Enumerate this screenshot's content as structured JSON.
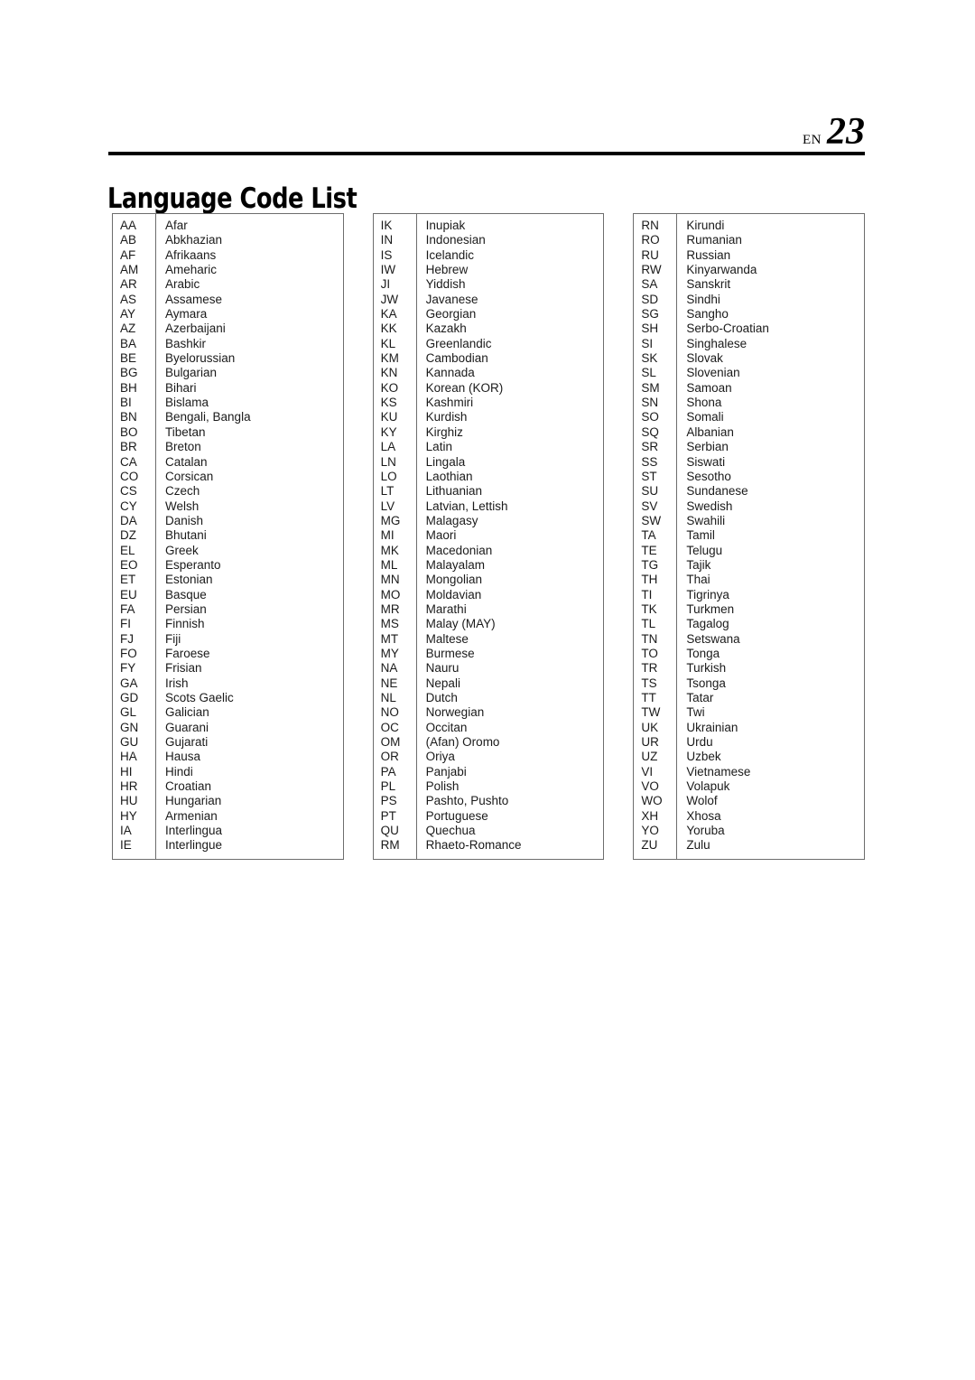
{
  "header": {
    "locale_label": "EN",
    "page_number": "23"
  },
  "title": "Language Code List",
  "tables": [
    {
      "name": "language-code-table-1",
      "rows": [
        {
          "code": "AA",
          "language": "Afar"
        },
        {
          "code": "AB",
          "language": "Abkhazian"
        },
        {
          "code": "AF",
          "language": "Afrikaans"
        },
        {
          "code": "AM",
          "language": "Ameharic"
        },
        {
          "code": "AR",
          "language": "Arabic"
        },
        {
          "code": "AS",
          "language": "Assamese"
        },
        {
          "code": "AY",
          "language": "Aymara"
        },
        {
          "code": "AZ",
          "language": "Azerbaijani"
        },
        {
          "code": "BA",
          "language": "Bashkir"
        },
        {
          "code": "BE",
          "language": "Byelorussian"
        },
        {
          "code": "BG",
          "language": "Bulgarian"
        },
        {
          "code": "BH",
          "language": "Bihari"
        },
        {
          "code": "BI",
          "language": "Bislama"
        },
        {
          "code": "BN",
          "language": "Bengali, Bangla"
        },
        {
          "code": "BO",
          "language": "Tibetan"
        },
        {
          "code": "BR",
          "language": "Breton"
        },
        {
          "code": "CA",
          "language": "Catalan"
        },
        {
          "code": "CO",
          "language": "Corsican"
        },
        {
          "code": "CS",
          "language": "Czech"
        },
        {
          "code": "CY",
          "language": "Welsh"
        },
        {
          "code": "DA",
          "language": "Danish"
        },
        {
          "code": "DZ",
          "language": "Bhutani"
        },
        {
          "code": "EL",
          "language": "Greek"
        },
        {
          "code": "EO",
          "language": "Esperanto"
        },
        {
          "code": "ET",
          "language": "Estonian"
        },
        {
          "code": "EU",
          "language": "Basque"
        },
        {
          "code": "FA",
          "language": "Persian"
        },
        {
          "code": "FI",
          "language": "Finnish"
        },
        {
          "code": "FJ",
          "language": "Fiji"
        },
        {
          "code": "FO",
          "language": "Faroese"
        },
        {
          "code": "FY",
          "language": "Frisian"
        },
        {
          "code": "GA",
          "language": "Irish"
        },
        {
          "code": "GD",
          "language": "Scots Gaelic"
        },
        {
          "code": "GL",
          "language": "Galician"
        },
        {
          "code": "GN",
          "language": "Guarani"
        },
        {
          "code": "GU",
          "language": "Gujarati"
        },
        {
          "code": "HA",
          "language": "Hausa"
        },
        {
          "code": "HI",
          "language": "Hindi"
        },
        {
          "code": "HR",
          "language": "Croatian"
        },
        {
          "code": "HU",
          "language": "Hungarian"
        },
        {
          "code": "HY",
          "language": "Armenian"
        },
        {
          "code": "IA",
          "language": "Interlingua"
        },
        {
          "code": "IE",
          "language": "Interlingue"
        }
      ]
    },
    {
      "name": "language-code-table-2",
      "rows": [
        {
          "code": "IK",
          "language": "Inupiak"
        },
        {
          "code": "IN",
          "language": "Indonesian"
        },
        {
          "code": "IS",
          "language": "Icelandic"
        },
        {
          "code": "IW",
          "language": "Hebrew"
        },
        {
          "code": "JI",
          "language": "Yiddish"
        },
        {
          "code": "JW",
          "language": "Javanese"
        },
        {
          "code": "KA",
          "language": "Georgian"
        },
        {
          "code": "KK",
          "language": "Kazakh"
        },
        {
          "code": "KL",
          "language": "Greenlandic"
        },
        {
          "code": "KM",
          "language": "Cambodian"
        },
        {
          "code": "KN",
          "language": "Kannada"
        },
        {
          "code": "KO",
          "language": "Korean (KOR)"
        },
        {
          "code": "KS",
          "language": "Kashmiri"
        },
        {
          "code": "KU",
          "language": "Kurdish"
        },
        {
          "code": "KY",
          "language": "Kirghiz"
        },
        {
          "code": "LA",
          "language": "Latin"
        },
        {
          "code": "LN",
          "language": "Lingala"
        },
        {
          "code": "LO",
          "language": "Laothian"
        },
        {
          "code": "LT",
          "language": "Lithuanian"
        },
        {
          "code": "LV",
          "language": "Latvian, Lettish"
        },
        {
          "code": "MG",
          "language": "Malagasy"
        },
        {
          "code": "MI",
          "language": "Maori"
        },
        {
          "code": "MK",
          "language": "Macedonian"
        },
        {
          "code": "ML",
          "language": "Malayalam"
        },
        {
          "code": "MN",
          "language": "Mongolian"
        },
        {
          "code": "MO",
          "language": "Moldavian"
        },
        {
          "code": "MR",
          "language": "Marathi"
        },
        {
          "code": "MS",
          "language": "Malay (MAY)"
        },
        {
          "code": "MT",
          "language": "Maltese"
        },
        {
          "code": "MY",
          "language": "Burmese"
        },
        {
          "code": "NA",
          "language": "Nauru"
        },
        {
          "code": "NE",
          "language": "Nepali"
        },
        {
          "code": "NL",
          "language": "Dutch"
        },
        {
          "code": "NO",
          "language": "Norwegian"
        },
        {
          "code": "OC",
          "language": "Occitan"
        },
        {
          "code": "OM",
          "language": "(Afan) Oromo"
        },
        {
          "code": "OR",
          "language": "Oriya"
        },
        {
          "code": "PA",
          "language": "Panjabi"
        },
        {
          "code": "PL",
          "language": "Polish"
        },
        {
          "code": "PS",
          "language": "Pashto, Pushto"
        },
        {
          "code": "PT",
          "language": "Portuguese"
        },
        {
          "code": "QU",
          "language": "Quechua"
        },
        {
          "code": "RM",
          "language": "Rhaeto-Romance"
        }
      ]
    },
    {
      "name": "language-code-table-3",
      "rows": [
        {
          "code": "RN",
          "language": "Kirundi"
        },
        {
          "code": "RO",
          "language": "Rumanian"
        },
        {
          "code": "RU",
          "language": "Russian"
        },
        {
          "code": "RW",
          "language": "Kinyarwanda"
        },
        {
          "code": "SA",
          "language": "Sanskrit"
        },
        {
          "code": "SD",
          "language": "Sindhi"
        },
        {
          "code": "SG",
          "language": "Sangho"
        },
        {
          "code": "SH",
          "language": "Serbo-Croatian"
        },
        {
          "code": "SI",
          "language": "Singhalese"
        },
        {
          "code": "SK",
          "language": "Slovak"
        },
        {
          "code": "SL",
          "language": "Slovenian"
        },
        {
          "code": "SM",
          "language": "Samoan"
        },
        {
          "code": "SN",
          "language": "Shona"
        },
        {
          "code": "SO",
          "language": "Somali"
        },
        {
          "code": "SQ",
          "language": "Albanian"
        },
        {
          "code": "SR",
          "language": "Serbian"
        },
        {
          "code": "SS",
          "language": "Siswati"
        },
        {
          "code": "ST",
          "language": "Sesotho"
        },
        {
          "code": "SU",
          "language": "Sundanese"
        },
        {
          "code": "SV",
          "language": "Swedish"
        },
        {
          "code": "SW",
          "language": "Swahili"
        },
        {
          "code": "TA",
          "language": "Tamil"
        },
        {
          "code": "TE",
          "language": "Telugu"
        },
        {
          "code": "TG",
          "language": "Tajik"
        },
        {
          "code": "TH",
          "language": "Thai"
        },
        {
          "code": "TI",
          "language": "Tigrinya"
        },
        {
          "code": "TK",
          "language": "Turkmen"
        },
        {
          "code": "TL",
          "language": "Tagalog"
        },
        {
          "code": "TN",
          "language": "Setswana"
        },
        {
          "code": "TO",
          "language": "Tonga"
        },
        {
          "code": "TR",
          "language": "Turkish"
        },
        {
          "code": "TS",
          "language": "Tsonga"
        },
        {
          "code": "TT",
          "language": "Tatar"
        },
        {
          "code": "TW",
          "language": "Twi"
        },
        {
          "code": "UK",
          "language": "Ukrainian"
        },
        {
          "code": "UR",
          "language": "Urdu"
        },
        {
          "code": "UZ",
          "language": "Uzbek"
        },
        {
          "code": "VI",
          "language": "Vietnamese"
        },
        {
          "code": "VO",
          "language": "Volapuk"
        },
        {
          "code": "WO",
          "language": "Wolof"
        },
        {
          "code": "XH",
          "language": "Xhosa"
        },
        {
          "code": "YO",
          "language": "Yoruba"
        },
        {
          "code": "ZU",
          "language": "Zulu"
        }
      ]
    }
  ],
  "colors": {
    "text": "#1a1a1a",
    "rule": "#000000",
    "table_border": "#6d6d6d",
    "page_background": "#ffffff"
  }
}
